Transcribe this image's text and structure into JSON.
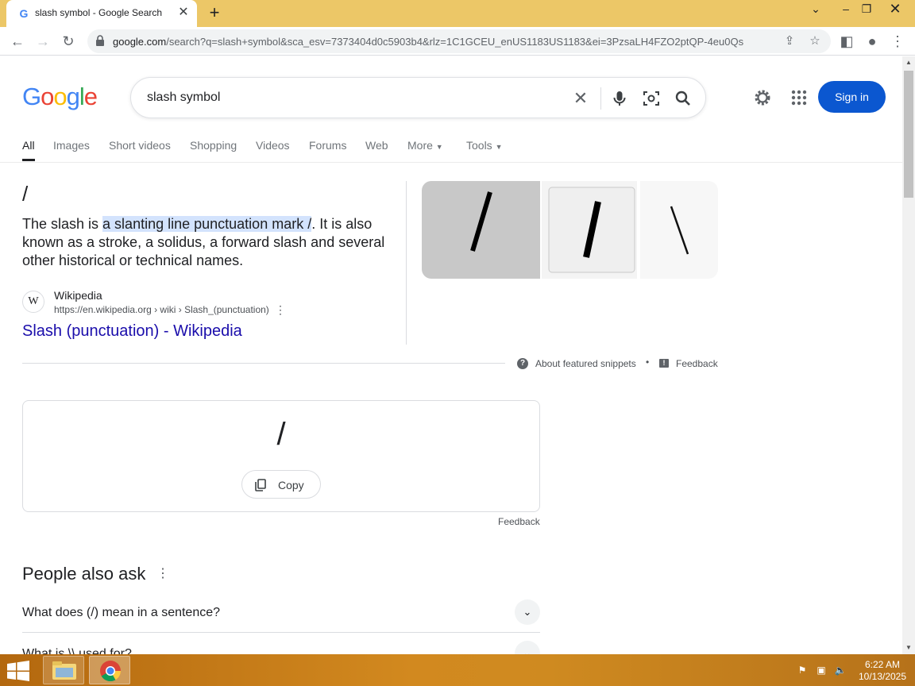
{
  "browser": {
    "tab_title": "slash symbol - Google Search",
    "tab_favicon": "G",
    "url_host": "google.com",
    "url_rest": "/search?q=slash+symbol&sca_esv=7373404d0c5903b4&rlz=1C1GCEU_enUS1183US1183&ei=3PzsaLH4FZO2ptQP-4eu0Qs"
  },
  "google": {
    "logo": "Google",
    "query": "slash symbol",
    "sign_in": "Sign in",
    "tabs": [
      "All",
      "Images",
      "Short videos",
      "Shopping",
      "Videos",
      "Forums",
      "Web",
      "More",
      "Tools"
    ]
  },
  "snippet": {
    "answer": "/",
    "text_before": "The slash is ",
    "text_highlight": "a slanting line punctuation mark /",
    "text_after": ". It is also known as a stroke, a solidus, a forward slash and several other historical or technical names.",
    "source_name": "Wikipedia",
    "source_url": "https://en.wikipedia.org › wiki › Slash_(punctuation)",
    "link_title": "Slash (punctuation) - Wikipedia",
    "about": "About featured snippets",
    "separator": "•",
    "feedback": "Feedback"
  },
  "symbol_card": {
    "symbol": "/",
    "copy_label": "Copy",
    "feedback": "Feedback"
  },
  "paa": {
    "title": "People also ask",
    "questions": [
      "What does (/) mean in a sentence?",
      "What is \\\\ used for?"
    ]
  },
  "taskbar": {
    "time": "6:22 AM",
    "date": "10/13/2025"
  },
  "colors": {
    "tabbar": "#ecc767",
    "sign_in_bg": "#0b57d0",
    "link": "#1a0dab",
    "highlight": "#d3e3fd"
  }
}
